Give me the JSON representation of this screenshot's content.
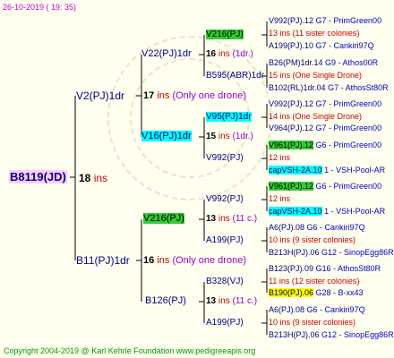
{
  "header": "26-10-2019 ( 19: 35)",
  "footer": "Copyright 2004-2019 @ Karl Kehrle Foundation   www.pedigreeapis.org",
  "root": {
    "name": "B8119(JD)",
    "num": "18",
    "ins": "ins"
  },
  "gen1": [
    {
      "name": "V2(PJ)1dr",
      "num": "17",
      "ins": "ins",
      "note": "(Only one drone)"
    },
    {
      "name": "B11(PJ)1dr",
      "num": "16",
      "ins": "ins",
      "note": "(Only one drone)"
    }
  ],
  "gen2": [
    {
      "name": "V22(PJ)1dr",
      "num": "",
      "ins": "",
      "note": ""
    },
    {
      "name": "V16(PJ)1dr",
      "num": "15",
      "ins": "ins",
      "note": "(1dr.)"
    },
    {
      "name": "V216(PJ)",
      "num": "13",
      "ins": "ins",
      "note": "(11 c.)"
    },
    {
      "name": "B126(PJ)",
      "num": "13",
      "ins": "ins",
      "note": "(11 c.)"
    }
  ],
  "gen3": [
    {
      "name": "V216(PJ)",
      "num": "16",
      "ins": "ins",
      "note": "(1dr.)"
    },
    {
      "name": "B595(ABR)1dr",
      "num": "",
      "ins": "",
      "note": ""
    },
    {
      "name": "V95(PJ)1dr",
      "num": "14",
      "ins": "ins",
      "note": "(One Single Drone)"
    },
    {
      "name": "V992(PJ)",
      "num": "",
      "ins": "",
      "note": ""
    },
    {
      "name": "V992(PJ)",
      "num": "12",
      "ins": "ins",
      "note": ""
    },
    {
      "name": "A199(PJ)",
      "num": "",
      "ins": "",
      "note": ""
    },
    {
      "name": "B328(VJ)",
      "num": "11",
      "ins": "ins",
      "note": "(12 sister colonies)"
    },
    {
      "name": "A199(PJ)",
      "num": "10",
      "ins": "ins",
      "note": "(9 sister colonies)"
    }
  ],
  "gen4": [
    {
      "name": "V992(PJ).12",
      "src": "G7 - PrimGreen00"
    },
    {
      "name": "13 ins (11 sister colonies)",
      "src": ""
    },
    {
      "name": "A199(PJ).10",
      "src": "G7 - Cankiri97Q"
    },
    {
      "name": "B26(PM)1dr.14",
      "src": "G9 - Athos00R"
    },
    {
      "name": "15 ins (One Single Drone)",
      "src": ""
    },
    {
      "name": "B102(RL)1dr.04",
      "src": "G7 - AthosSt80R"
    },
    {
      "name": "V992(PJ).12",
      "src": "G7 - PrimGreen00"
    },
    {
      "name": "14 ins (One Single Drone)",
      "src": ""
    },
    {
      "name": "V964(PJ).12",
      "src": "G7 - PrimGreen00"
    },
    {
      "name": "V961(PJ).12",
      "src": "G6 - PrimGreen00"
    },
    {
      "name": "12 ins",
      "src": ""
    },
    {
      "name": "capVSH-2A.10",
      "src": "1 - VSH-Pool-AR"
    },
    {
      "name": "V961(PJ).12",
      "src": "G6 - PrimGreen00"
    },
    {
      "name": "12 ins",
      "src": ""
    },
    {
      "name": "capVSH-2A.10",
      "src": "1 - VSH-Pool-AR"
    },
    {
      "name": "A6(PJ).08",
      "src": "G6 - Cankiri97Q"
    },
    {
      "name": "10 ins (9 sister colonies)",
      "src": ""
    },
    {
      "name": "B213H(PJ).06",
      "src": "G12 - SinopEgg86R"
    },
    {
      "name": "B123(PJ).09",
      "src": "G16 - AthosSt80R"
    },
    {
      "name": "11 ins (12 sister colonies)",
      "src": ""
    },
    {
      "name": "B190(PJ).06",
      "src": "G28 - B-xx43"
    },
    {
      "name": "A6(PJ).08",
      "src": "G6 - Cankiri97Q"
    },
    {
      "name": "10 ins (9 sister colonies)",
      "src": ""
    },
    {
      "name": "B213H(PJ).06",
      "src": "G12 - SinopEgg86R"
    }
  ],
  "colors": {
    "line": "#000000",
    "green": "#33cc33",
    "cyan": "#00ffff",
    "yellow": "#ffff00",
    "root_bg": "#ffccff"
  }
}
